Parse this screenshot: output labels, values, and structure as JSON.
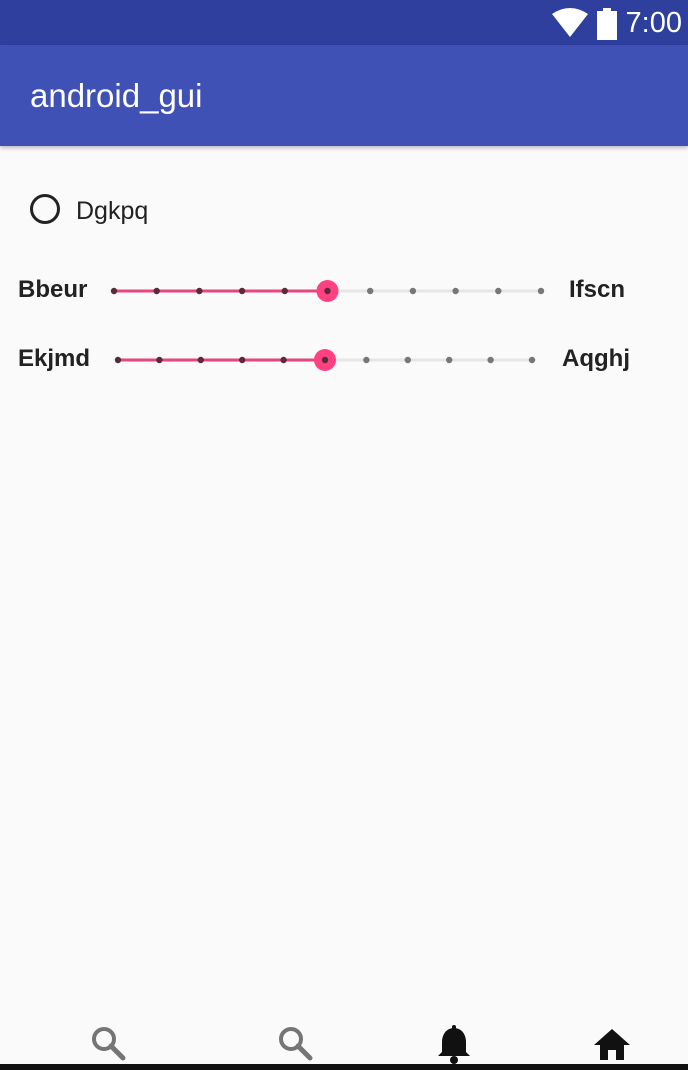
{
  "status_bar": {
    "time": "7:00"
  },
  "app_bar": {
    "title": "android_gui"
  },
  "radio": {
    "label": "Dgkpq",
    "checked": false
  },
  "seekbars": [
    {
      "left_label": "Bbeur",
      "right_label": "Ifscn",
      "ticks": 11,
      "progress_step": 5
    },
    {
      "left_label": "Ekjmd",
      "right_label": "Aqghj",
      "ticks": 11,
      "progress_step": 5
    }
  ],
  "colors": {
    "status_bar": "#2f3f9e",
    "app_bar": "#3f51b5",
    "accent": "#ff4081",
    "track_active": "#e8457f"
  },
  "bottom_nav": [
    {
      "icon": "search-icon"
    },
    {
      "icon": "search-icon"
    },
    {
      "icon": "bell-icon"
    },
    {
      "icon": "home-icon"
    }
  ]
}
